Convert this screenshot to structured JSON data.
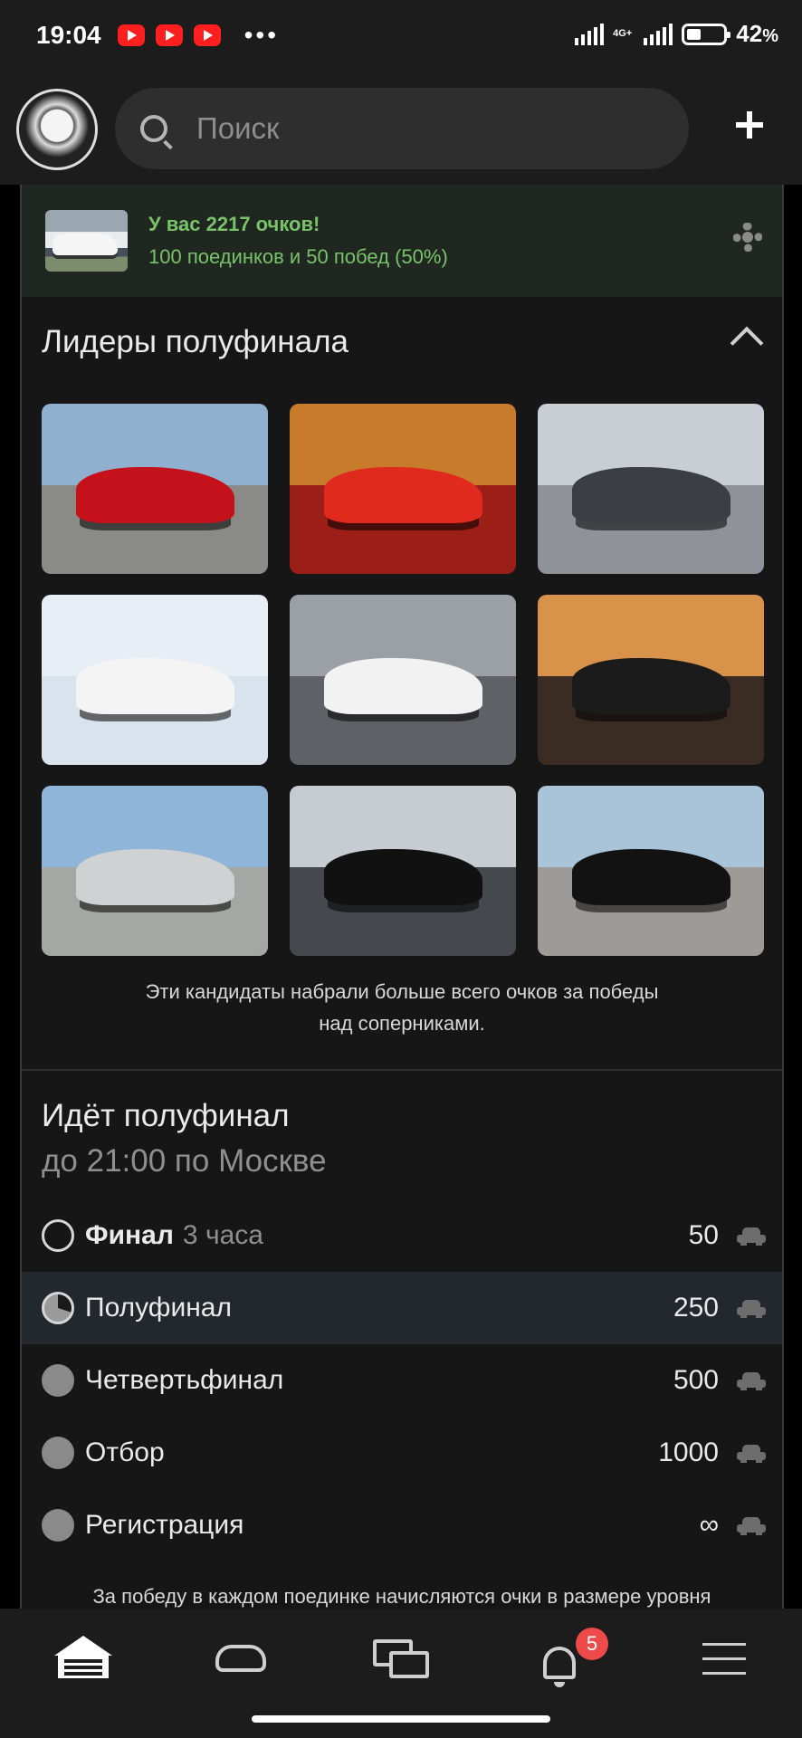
{
  "status_bar": {
    "time": "19:04",
    "network_label": "4G+",
    "battery": "42",
    "battery_unit": "%"
  },
  "header": {
    "search_placeholder": "Поиск",
    "add_icon": "plus-icon",
    "avatar_icon": "profile-emblem"
  },
  "score": {
    "title": "У вас 2217 очков!",
    "subtitle": "100 поединков и 50 побед (50%)"
  },
  "leaders": {
    "title": "Лидеры полуфинала",
    "caption_line1": "Эти кандидаты набрали больше всего очков за победы",
    "caption_line2": "над соперниками.",
    "tiles": [
      {
        "alt": "red sports car with woman",
        "sky": "#8fb1cf",
        "ground": "#8a8a86",
        "car": "#c5111b"
      },
      {
        "alt": "red Toyota Celica with woman",
        "sky": "#c87b2a",
        "ground": "#9b1f17",
        "car": "#e02a1e"
      },
      {
        "alt": "grey Audi A5",
        "sky": "#c9ced4",
        "ground": "#8f9299",
        "car": "#3b3f44"
      },
      {
        "alt": "white Toyota Crown in snow",
        "sky": "#e7eef6",
        "ground": "#d9e3ee",
        "car": "#f4f4f4"
      },
      {
        "alt": "white Porsche 911 on track",
        "sky": "#9aa0a6",
        "ground": "#5f6166",
        "car": "#f2f2f2"
      },
      {
        "alt": "black sedan at mountain sunset",
        "sky": "#d8924a",
        "ground": "#3a2c22",
        "car": "#1b1b1b"
      },
      {
        "alt": "silver Toyota Mark II",
        "sky": "#8fb6d8",
        "ground": "#a4a7a3",
        "car": "#cfd1d3"
      },
      {
        "alt": "black BMW 7 series",
        "sky": "#c6ccd2",
        "ground": "#45484c",
        "car": "#111111"
      },
      {
        "alt": "black Toyota Camry Solara",
        "sky": "#a9c3d9",
        "ground": "#9d9b97",
        "car": "#121212"
      }
    ]
  },
  "round": {
    "title": "Идёт полуфинал",
    "subtitle": "до 21:00 по Москве",
    "stages": [
      {
        "name": "Финал",
        "extra": "3 часа",
        "count": "50",
        "state": "empty"
      },
      {
        "name": "Полуфинал",
        "extra": "",
        "count": "250",
        "state": "partial"
      },
      {
        "name": "Четвертьфинал",
        "extra": "",
        "count": "500",
        "state": "full"
      },
      {
        "name": "Отбор",
        "extra": "",
        "count": "1000",
        "state": "full"
      },
      {
        "name": "Регистрация",
        "extra": "",
        "count": "∞",
        "state": "full"
      }
    ],
    "footnote": "За победу в каждом поединке начисляются очки в размере уровня"
  },
  "bottom_nav": {
    "items": [
      "garage-home-icon",
      "car-icon",
      "chat-icon",
      "bell-icon",
      "menu-icon"
    ],
    "notifications_badge": "5"
  }
}
